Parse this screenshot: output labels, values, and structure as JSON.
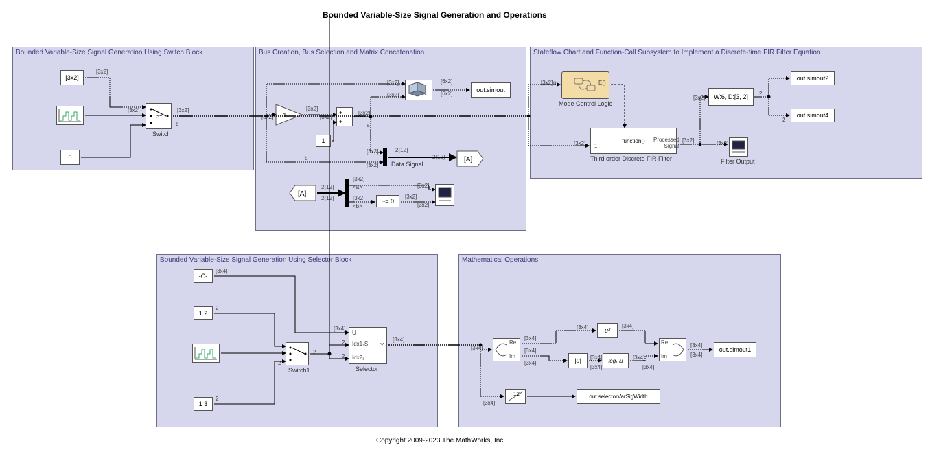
{
  "title": "Bounded Variable-Size Signal Generation and Operations",
  "copyright": "Copyright 2009-2023 The MathWorks, Inc.",
  "regions": {
    "r1": "Bounded Variable-Size Signal Generation Using Switch Block",
    "r2": "Bus Creation, Bus Selection and Matrix Concatenation",
    "r3": "Stateflow Chart and Function-Call Subsystem to Implement a Discrete-time FIR Filter Equation",
    "r4": "Bounded Variable-Size Signal Generation Using Selector Block",
    "r5": "Mathematical Operations"
  },
  "blocks": {
    "const3x2": "[3x2]",
    "const0": "0",
    "switch": "Switch",
    "gain": "1",
    "const1": "1",
    "outsim": "out.simout",
    "outsim1": "out.simout1",
    "outsim2": "out.simout2",
    "outsim4": "out.simout4",
    "gotoA": "[A]",
    "fromA": "[A]",
    "neq0": "~= 0",
    "mode": "Mode Control Logic",
    "fir": "Third order Discrete FIR Filter",
    "firFunc": "function()",
    "firProc": "Processed\nSignal",
    "delay": "W:6, D:[3, 2]",
    "filterOut": "Filter Output",
    "constC": "-C-",
    "const12a": "1  2",
    "const13": "1  3",
    "switch1": "Switch1",
    "selector": "Selector",
    "selY": "Y",
    "selU": "U",
    "selIdx1": "Idx1₁S",
    "selIdx2": "Idx2₁",
    "usq": "u²",
    "abs": "|u|",
    "log10": "log₁₀u",
    "reim1_re": "Re",
    "reim1_im": "Im",
    "reim2_re": "Re",
    "reim2_im": "Im",
    "width": "12",
    "dataSignal": "Data Signal",
    "outSelVar": "out.selectorVarSigWidth",
    "concat1": "1"
  },
  "sig": {
    "d3x2": "[3x2]",
    "d3x4": "[3x4]",
    "d6x2": "[6x2]",
    "d2": "2",
    "d12": "2{12}",
    "a": "a",
    "b": "b",
    "a_sel": "<a>",
    "b_sel": "<b>",
    "u": "u",
    "E": "E()",
    "one": "1",
    "twelve": "12"
  }
}
